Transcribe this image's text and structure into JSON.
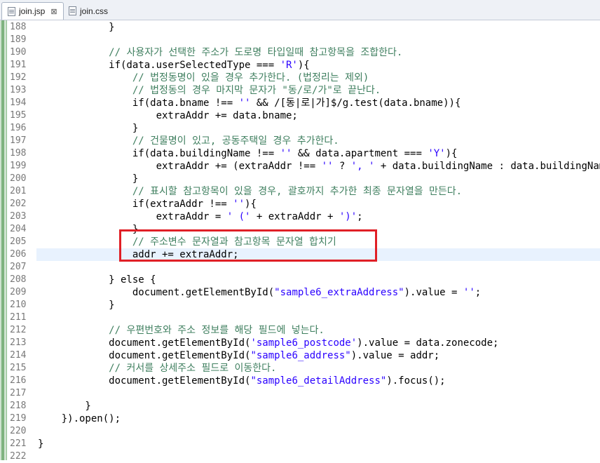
{
  "tabs": [
    {
      "label": "join.jsp",
      "close": "⊠",
      "active": true
    },
    {
      "label": "join.css",
      "active": false
    }
  ],
  "colors": {
    "comment": "#3f7f5f",
    "string": "#2a00ff",
    "highlight_box": "#e01f26",
    "current_line": "#e8f2fe"
  },
  "current_line": 206,
  "lines": [
    {
      "n": "188",
      "text": "            }"
    },
    {
      "n": "189",
      "text": ""
    },
    {
      "n": "190",
      "text": "            // 사용자가 선택한 주소가 도로명 타입일때 참고항목을 조합한다."
    },
    {
      "n": "191",
      "text": "            if(data.userSelectedType === 'R'){"
    },
    {
      "n": "192",
      "text": "                // 법정동명이 있을 경우 추가한다. (법정리는 제외)"
    },
    {
      "n": "193",
      "text": "                // 법정동의 경우 마지막 문자가 \"동/로/가\"로 끝난다."
    },
    {
      "n": "194",
      "text": "                if(data.bname !== '' && /[동|로|가]$/g.test(data.bname)){"
    },
    {
      "n": "195",
      "text": "                    extraAddr += data.bname;"
    },
    {
      "n": "196",
      "text": "                }"
    },
    {
      "n": "197",
      "text": "                // 건물명이 있고, 공동주택일 경우 추가한다."
    },
    {
      "n": "198",
      "text": "                if(data.buildingName !== '' && data.apartment === 'Y'){"
    },
    {
      "n": "199",
      "text": "                    extraAddr += (extraAddr !== '' ? ', ' + data.buildingName : data.buildingName);"
    },
    {
      "n": "200",
      "text": "                }"
    },
    {
      "n": "201",
      "text": "                // 표시할 참고항목이 있을 경우, 괄호까지 추가한 최종 문자열을 만든다."
    },
    {
      "n": "202",
      "text": "                if(extraAddr !== ''){"
    },
    {
      "n": "203",
      "text": "                    extraAddr = ' (' + extraAddr + ')';"
    },
    {
      "n": "204",
      "text": "                }"
    },
    {
      "n": "205",
      "text": "                // 주소변수 문자열과 참고항목 문자열 합치기"
    },
    {
      "n": "206",
      "text": "                addr += extraAddr;"
    },
    {
      "n": "207",
      "text": ""
    },
    {
      "n": "208",
      "text": "            } else {"
    },
    {
      "n": "209",
      "text": "                document.getElementById(\"sample6_extraAddress\").value = '';"
    },
    {
      "n": "210",
      "text": "            }"
    },
    {
      "n": "211",
      "text": ""
    },
    {
      "n": "212",
      "text": "            // 우편번호와 주소 정보를 해당 필드에 넣는다."
    },
    {
      "n": "213",
      "text": "            document.getElementById('sample6_postcode').value = data.zonecode;"
    },
    {
      "n": "214",
      "text": "            document.getElementById(\"sample6_address\").value = addr;"
    },
    {
      "n": "215",
      "text": "            // 커서를 상세주소 필드로 이동한다."
    },
    {
      "n": "216",
      "text": "            document.getElementById(\"sample6_detailAddress\").focus();"
    },
    {
      "n": "217",
      "text": ""
    },
    {
      "n": "218",
      "text": "        }"
    },
    {
      "n": "219",
      "text": "    }).open();"
    },
    {
      "n": "220",
      "text": ""
    },
    {
      "n": "221",
      "text": "}"
    },
    {
      "n": "222",
      "text": ""
    }
  ]
}
